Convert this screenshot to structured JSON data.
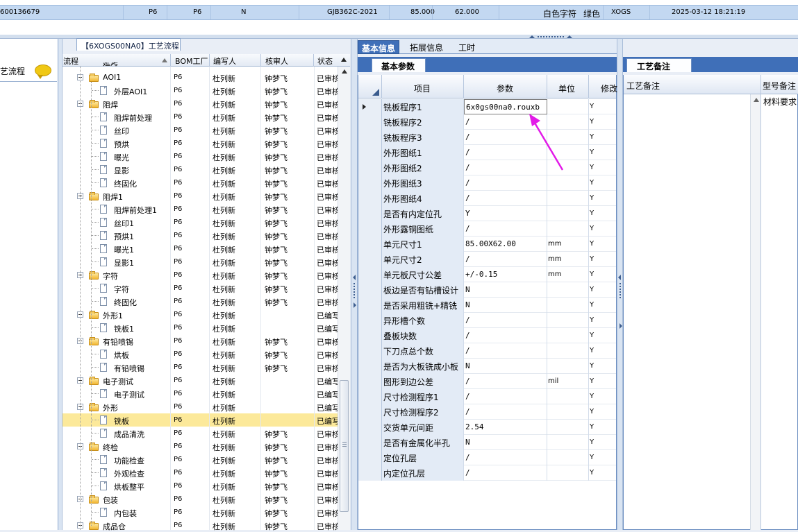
{
  "top_record": {
    "cells": [
      "600136679",
      "P6",
      "P6",
      "N",
      "GJB362C-2021",
      "85.000",
      "62.000",
      "白色字符",
      "绿色",
      "XOGS",
      "2025-03-12 18:21:19"
    ]
  },
  "left_panel": {
    "title_fragment": "艺流程",
    "chat_icon": "chat-bubble-icon"
  },
  "process_tree": {
    "tab_label": "【6XOGS00NA0】工艺流程",
    "headers": [
      "流程",
      "BOM工厂",
      "编写人",
      "核审人",
      "状态"
    ],
    "partial_top_label": "延烤",
    "rows": [
      {
        "label": "AOI1",
        "type": "folder",
        "factory": "P6",
        "author": "杜列新",
        "reviewer": "钟梦飞",
        "status": "已审核"
      },
      {
        "label": "外层AOI1",
        "type": "doc",
        "factory": "P6",
        "author": "杜列新",
        "reviewer": "钟梦飞",
        "status": "已审核"
      },
      {
        "label": "阻焊",
        "type": "folder",
        "factory": "P6",
        "author": "杜列新",
        "reviewer": "钟梦飞",
        "status": "已审核"
      },
      {
        "label": "阻焊前处理",
        "type": "doc",
        "factory": "P6",
        "author": "杜列新",
        "reviewer": "钟梦飞",
        "status": "已审核"
      },
      {
        "label": "丝印",
        "type": "doc",
        "factory": "P6",
        "author": "杜列新",
        "reviewer": "钟梦飞",
        "status": "已审核"
      },
      {
        "label": "预烘",
        "type": "doc",
        "factory": "P6",
        "author": "杜列新",
        "reviewer": "钟梦飞",
        "status": "已审核"
      },
      {
        "label": "曝光",
        "type": "doc",
        "factory": "P6",
        "author": "杜列新",
        "reviewer": "钟梦飞",
        "status": "已审核"
      },
      {
        "label": "显影",
        "type": "doc",
        "factory": "P6",
        "author": "杜列新",
        "reviewer": "钟梦飞",
        "status": "已审核"
      },
      {
        "label": "终固化",
        "type": "doc",
        "factory": "P6",
        "author": "杜列新",
        "reviewer": "钟梦飞",
        "status": "已审核"
      },
      {
        "label": "阻焊1",
        "type": "folder",
        "factory": "P6",
        "author": "杜列新",
        "reviewer": "钟梦飞",
        "status": "已审核"
      },
      {
        "label": "阻焊前处理1",
        "type": "doc",
        "factory": "P6",
        "author": "杜列新",
        "reviewer": "钟梦飞",
        "status": "已审核"
      },
      {
        "label": "丝印1",
        "type": "doc",
        "factory": "P6",
        "author": "杜列新",
        "reviewer": "钟梦飞",
        "status": "已审核"
      },
      {
        "label": "预烘1",
        "type": "doc",
        "factory": "P6",
        "author": "杜列新",
        "reviewer": "钟梦飞",
        "status": "已审核"
      },
      {
        "label": "曝光1",
        "type": "doc",
        "factory": "P6",
        "author": "杜列新",
        "reviewer": "钟梦飞",
        "status": "已审核"
      },
      {
        "label": "显影1",
        "type": "doc",
        "factory": "P6",
        "author": "杜列新",
        "reviewer": "钟梦飞",
        "status": "已审核"
      },
      {
        "label": "字符",
        "type": "folder",
        "factory": "P6",
        "author": "杜列新",
        "reviewer": "钟梦飞",
        "status": "已审核"
      },
      {
        "label": "字符",
        "type": "doc",
        "factory": "P6",
        "author": "杜列新",
        "reviewer": "钟梦飞",
        "status": "已审核"
      },
      {
        "label": "终固化",
        "type": "doc",
        "factory": "P6",
        "author": "杜列新",
        "reviewer": "钟梦飞",
        "status": "已审核"
      },
      {
        "label": "外形1",
        "type": "folder",
        "factory": "P6",
        "author": "杜列新",
        "reviewer": "",
        "status": "已编写"
      },
      {
        "label": "铣板1",
        "type": "doc",
        "factory": "P6",
        "author": "杜列新",
        "reviewer": "",
        "status": "已编写"
      },
      {
        "label": "有铅喷锡",
        "type": "folder",
        "factory": "P6",
        "author": "杜列新",
        "reviewer": "钟梦飞",
        "status": "已审核"
      },
      {
        "label": "烘板",
        "type": "doc",
        "factory": "P6",
        "author": "杜列新",
        "reviewer": "钟梦飞",
        "status": "已审核"
      },
      {
        "label": "有铅喷锡",
        "type": "doc",
        "factory": "P6",
        "author": "杜列新",
        "reviewer": "钟梦飞",
        "status": "已审核"
      },
      {
        "label": "电子测试",
        "type": "folder",
        "factory": "P6",
        "author": "杜列新",
        "reviewer": "",
        "status": "已编写"
      },
      {
        "label": "电子测试",
        "type": "doc",
        "factory": "P6",
        "author": "杜列新",
        "reviewer": "",
        "status": "已编写"
      },
      {
        "label": "外形",
        "type": "folder",
        "factory": "P6",
        "author": "杜列新",
        "reviewer": "",
        "status": "已编写"
      },
      {
        "label": "铣板",
        "type": "doc",
        "factory": "P6",
        "author": "杜列新",
        "reviewer": "",
        "status": "已编写",
        "selected": true
      },
      {
        "label": "成品清洗",
        "type": "doc",
        "factory": "P6",
        "author": "杜列新",
        "reviewer": "钟梦飞",
        "status": "已审核"
      },
      {
        "label": "终检",
        "type": "folder",
        "factory": "P6",
        "author": "杜列新",
        "reviewer": "钟梦飞",
        "status": "已审核"
      },
      {
        "label": "功能检查",
        "type": "doc",
        "factory": "P6",
        "author": "杜列新",
        "reviewer": "钟梦飞",
        "status": "已审核"
      },
      {
        "label": "外观检查",
        "type": "doc",
        "factory": "P6",
        "author": "杜列新",
        "reviewer": "钟梦飞",
        "status": "已审核"
      },
      {
        "label": "烘板整平",
        "type": "doc",
        "factory": "P6",
        "author": "杜列新",
        "reviewer": "钟梦飞",
        "status": "已审核"
      },
      {
        "label": "包装",
        "type": "folder",
        "factory": "P6",
        "author": "杜列新",
        "reviewer": "钟梦飞",
        "status": "已审核"
      },
      {
        "label": "内包装",
        "type": "doc",
        "factory": "P6",
        "author": "杜列新",
        "reviewer": "钟梦飞",
        "status": "已审核"
      },
      {
        "label": "成品仓",
        "type": "folder",
        "factory": "P6",
        "author": "杜列新",
        "reviewer": "钟梦飞",
        "status": "已审核"
      }
    ]
  },
  "detail_tabs": [
    "基本信息",
    "拓展信息",
    "工时"
  ],
  "param_panel": {
    "subtab": "基本参数",
    "headers": [
      "项目",
      "参数",
      "单位",
      "修改"
    ],
    "rows": [
      {
        "item": "铣板程序1",
        "value": "6x0gs00na0.rouxb",
        "unit": "",
        "mod": "Y",
        "current": true
      },
      {
        "item": "铣板程序2",
        "value": "/",
        "unit": "",
        "mod": "Y"
      },
      {
        "item": "铣板程序3",
        "value": "/",
        "unit": "",
        "mod": "Y"
      },
      {
        "item": "外形图纸1",
        "value": "/",
        "unit": "",
        "mod": "Y"
      },
      {
        "item": "外形图纸2",
        "value": "/",
        "unit": "",
        "mod": "Y"
      },
      {
        "item": "外形图纸3",
        "value": "/",
        "unit": "",
        "mod": "Y"
      },
      {
        "item": "外形图纸4",
        "value": "/",
        "unit": "",
        "mod": "Y"
      },
      {
        "item": "是否有内定位孔",
        "value": "Y",
        "unit": "",
        "mod": "Y"
      },
      {
        "item": "外形露铜图纸",
        "value": "/",
        "unit": "",
        "mod": "Y"
      },
      {
        "item": "单元尺寸1",
        "value": "85.00X62.00",
        "unit": "mm",
        "mod": "Y"
      },
      {
        "item": "单元尺寸2",
        "value": "/",
        "unit": "mm",
        "mod": "Y"
      },
      {
        "item": "单元板尺寸公差",
        "value": "+/-0.15",
        "unit": "mm",
        "mod": "Y"
      },
      {
        "item": "板边是否有钻槽设计",
        "value": "N",
        "unit": "",
        "mod": "Y"
      },
      {
        "item": "是否采用粗铣+精铣",
        "value": "N",
        "unit": "",
        "mod": "Y"
      },
      {
        "item": "异形槽个数",
        "value": "/",
        "unit": "",
        "mod": "Y"
      },
      {
        "item": "叠板块数",
        "value": "/",
        "unit": "",
        "mod": "Y"
      },
      {
        "item": "下刀点总个数",
        "value": "/",
        "unit": "",
        "mod": "Y"
      },
      {
        "item": "是否为大板铣成小板",
        "value": "N",
        "unit": "",
        "mod": "Y"
      },
      {
        "item": "图形到边公差",
        "value": "/",
        "unit": "mil",
        "mod": "Y"
      },
      {
        "item": "尺寸检测程序1",
        "value": "/",
        "unit": "",
        "mod": "Y"
      },
      {
        "item": "尺寸检测程序2",
        "value": "/",
        "unit": "",
        "mod": "Y"
      },
      {
        "item": "交货单元间距",
        "value": "2.54",
        "unit": "",
        "mod": "Y"
      },
      {
        "item": "是否有金属化半孔",
        "value": "N",
        "unit": "",
        "mod": "Y"
      },
      {
        "item": "定位孔层",
        "value": "/",
        "unit": "",
        "mod": "Y"
      },
      {
        "item": "内定位孔层",
        "value": "/",
        "unit": "",
        "mod": "Y"
      }
    ]
  },
  "notes_panel": {
    "tab": "工艺备注",
    "headers": [
      "工艺备注",
      "型号备注"
    ],
    "model_note": "材料要求"
  },
  "annotation": {
    "color": "#e21be8"
  }
}
